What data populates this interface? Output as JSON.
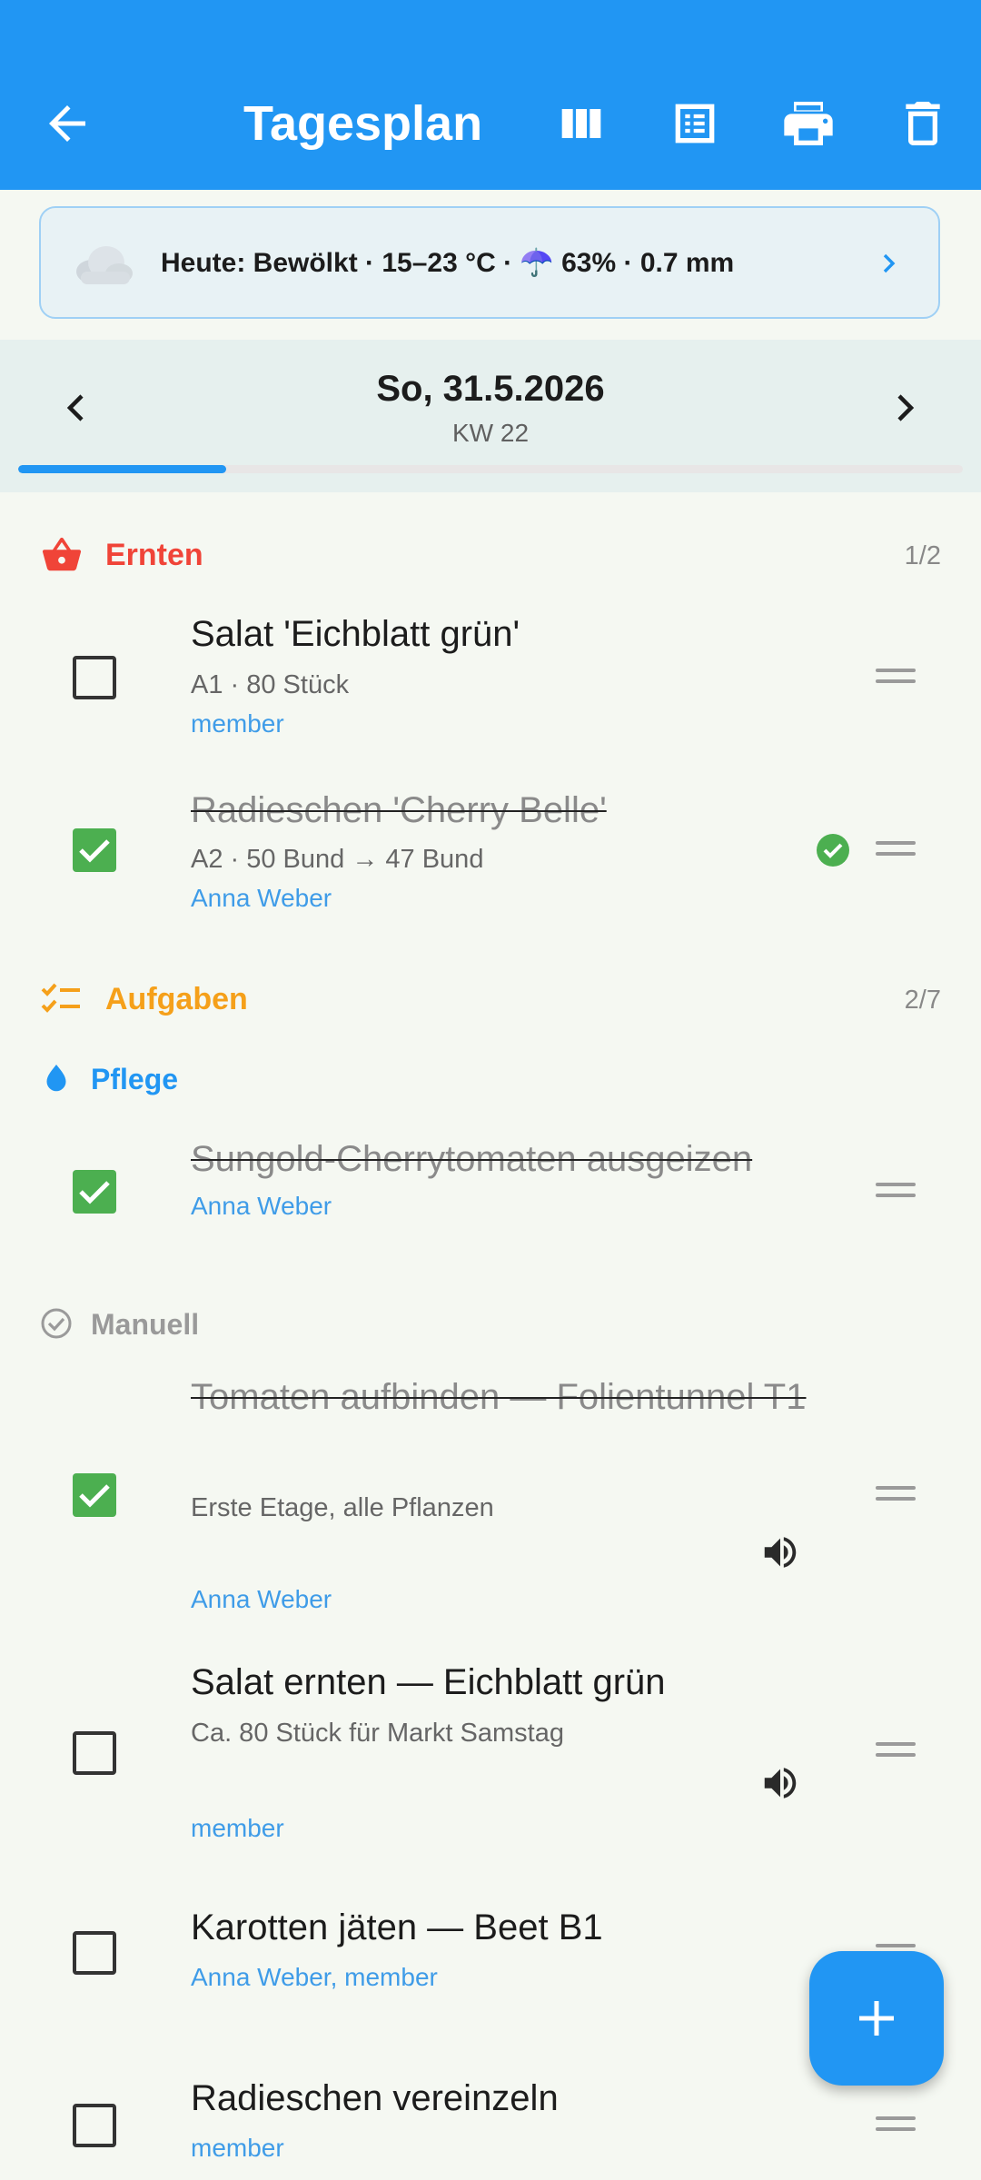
{
  "appbar": {
    "title": "Tagesplan",
    "back_icon": "arrow-back-icon",
    "actions": [
      "view-columns-icon",
      "list-view-icon",
      "print-icon",
      "delete-icon"
    ],
    "background": "#2196f3"
  },
  "weather": {
    "icon": "cloud-icon",
    "text": "Heute: Bewölkt · 15–23 °C · ☂️ 63% · 0.7 mm"
  },
  "date_nav": {
    "date": "So, 31.5.2026",
    "week": "KW 22",
    "progress": 0.22
  },
  "sections": {
    "ernten": {
      "label": "Ernten",
      "count": "1/2",
      "color": "#f04438",
      "items": [
        {
          "title": "Salat 'Eichblatt grün'",
          "detail": "A1 · 80 Stück",
          "assignee": "member",
          "done": false
        },
        {
          "title": "Radieschen 'Cherry Belle'",
          "detail": "A2 · 50 Bund → 47 Bund",
          "assignee": "Anna Weber",
          "done": true
        }
      ]
    },
    "aufgaben": {
      "label": "Aufgaben",
      "count": "2/7",
      "color": "#f5a01a",
      "pflege": {
        "label": "Pflege",
        "color": "#2196f3",
        "items": [
          {
            "title": "Sungold-Cherrytomaten ausgeizen",
            "assignee": "Anna Weber",
            "done": true
          }
        ]
      },
      "manuell": {
        "label": "Manuell",
        "color": "#9a9a9a",
        "items": [
          {
            "title": "Tomaten aufbinden — Folientunnel T1",
            "detail": "Erste Etage, alle Pflanzen",
            "assignee": "Anna Weber",
            "done": true
          },
          {
            "title": "Salat ernten — Eichblatt grün",
            "detail": "Ca. 80 Stück für Markt Samstag",
            "assignee": "member",
            "done": false
          },
          {
            "title": "Karotten jäten — Beet B1",
            "assignee": "Anna Weber, member",
            "done": false
          },
          {
            "title": "Radieschen vereinzeln",
            "assignee": "member",
            "done": false
          }
        ]
      }
    }
  },
  "colors": {
    "accent": "#2196f3",
    "checked": "#4caf50",
    "assignee": "#3f9ce8"
  }
}
